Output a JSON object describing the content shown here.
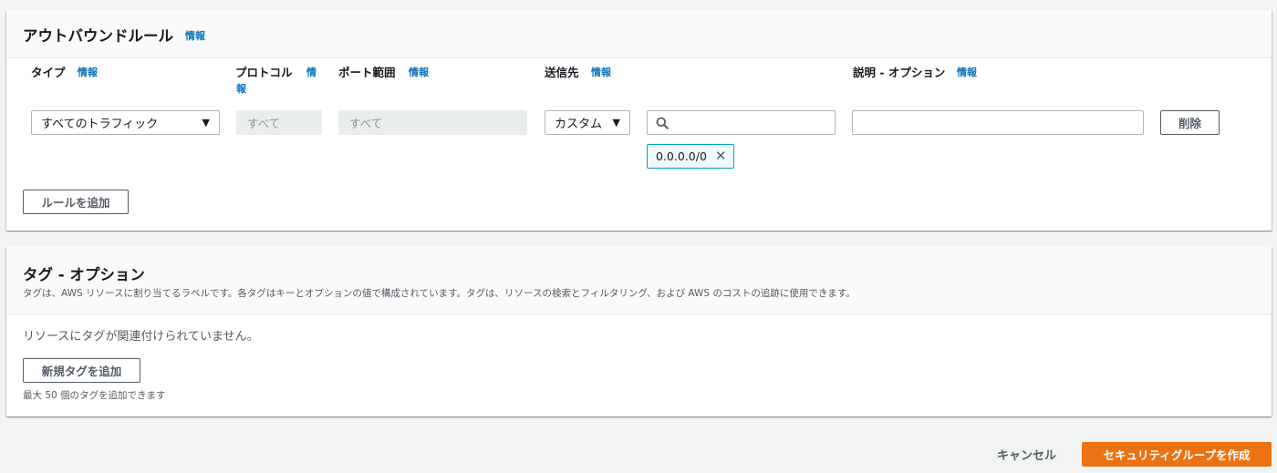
{
  "outbound": {
    "title": "アウトバウンドルール",
    "info": "情報",
    "columns": {
      "type": {
        "label": "タイプ",
        "info": "情報"
      },
      "protocol": {
        "label": "プロトコル",
        "info_1": "情",
        "info_2": "報"
      },
      "port_range": {
        "label": "ポート範囲",
        "info": "情報"
      },
      "destination": {
        "label": "送信先",
        "info": "情報"
      },
      "description": {
        "label": "説明 - オプション",
        "info": "情報"
      }
    },
    "row": {
      "type_value": "すべてのトラフィック",
      "protocol_value": "すべて",
      "port_value": "すべて",
      "destination_type": "カスタム",
      "cidr_search_value": "",
      "cidr_token": "0.0.0.0/0",
      "description_value": "",
      "delete_label": "削除"
    },
    "add_rule_label": "ルールを追加"
  },
  "tags": {
    "title": "タグ - オプション",
    "description": "タグは、AWS リソースに割り当てるラベルです。各タグはキーとオプションの値で構成されています。タグは、リソースの検索とフィルタリング、および AWS のコストの追跡に使用できます。",
    "empty_message": "リソースにタグが関連付けられていません。",
    "add_tag_label": "新規タグを追加",
    "limit_hint": "最大 50 個のタグを追加できます"
  },
  "footer": {
    "cancel_label": "キャンセル",
    "create_label": "セキュリティグループを作成"
  },
  "colors": {
    "accent": "#0073bb",
    "primary": "#ec7211",
    "token_border": "#00a1c9"
  },
  "icons": {
    "caret": "▼",
    "close": "✕"
  }
}
